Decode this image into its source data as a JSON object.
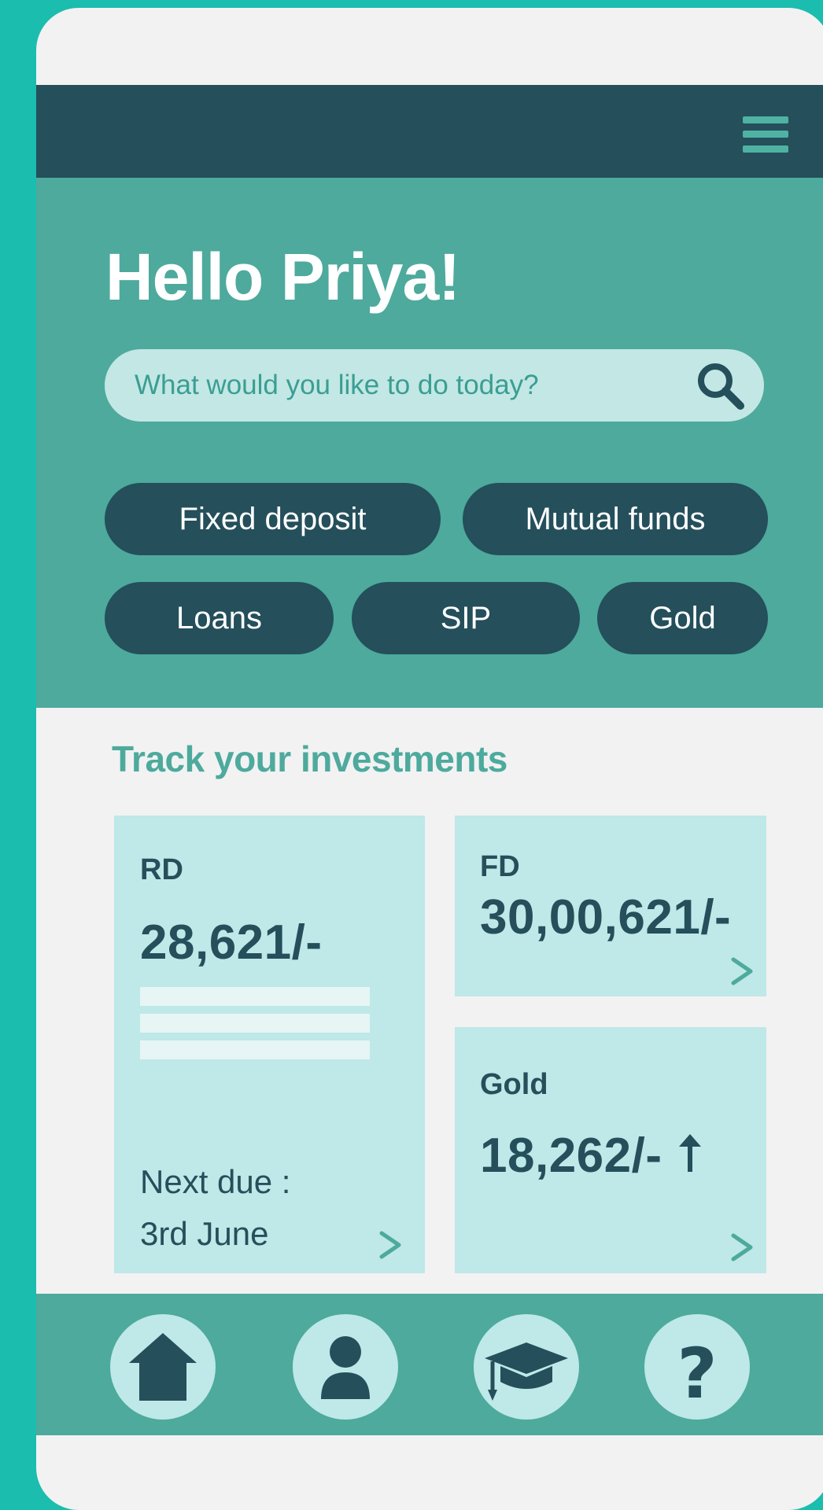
{
  "header": {
    "menu_icon": "hamburger-menu-icon"
  },
  "hero": {
    "greeting": "Hello Priya!",
    "search": {
      "placeholder": "What would you like to do today?",
      "icon": "search-icon"
    },
    "chips": [
      "Fixed deposit",
      "Mutual funds",
      "Loans",
      "SIP",
      "Gold"
    ]
  },
  "investments": {
    "title": "Track your investments",
    "rd": {
      "label": "RD",
      "value": "28,621/-",
      "next_due_label": "Next due :",
      "next_due_date": "3rd June"
    },
    "fd": {
      "label": "FD",
      "value": "30,00,621/-"
    },
    "gold": {
      "label": "Gold",
      "value": "18,262/-",
      "trend_icon": "arrow-up-icon"
    }
  },
  "bottom_nav": {
    "items": [
      {
        "icon": "home-icon"
      },
      {
        "icon": "profile-icon"
      },
      {
        "icon": "graduation-cap-icon"
      },
      {
        "icon": "help-icon"
      }
    ]
  },
  "colors": {
    "background_teal": "#1ABDAE",
    "dark_teal": "#244F5B",
    "mid_teal": "#4DAA9D",
    "light_teal": "#BFE8E8",
    "page_bg": "#F2F2F2"
  }
}
